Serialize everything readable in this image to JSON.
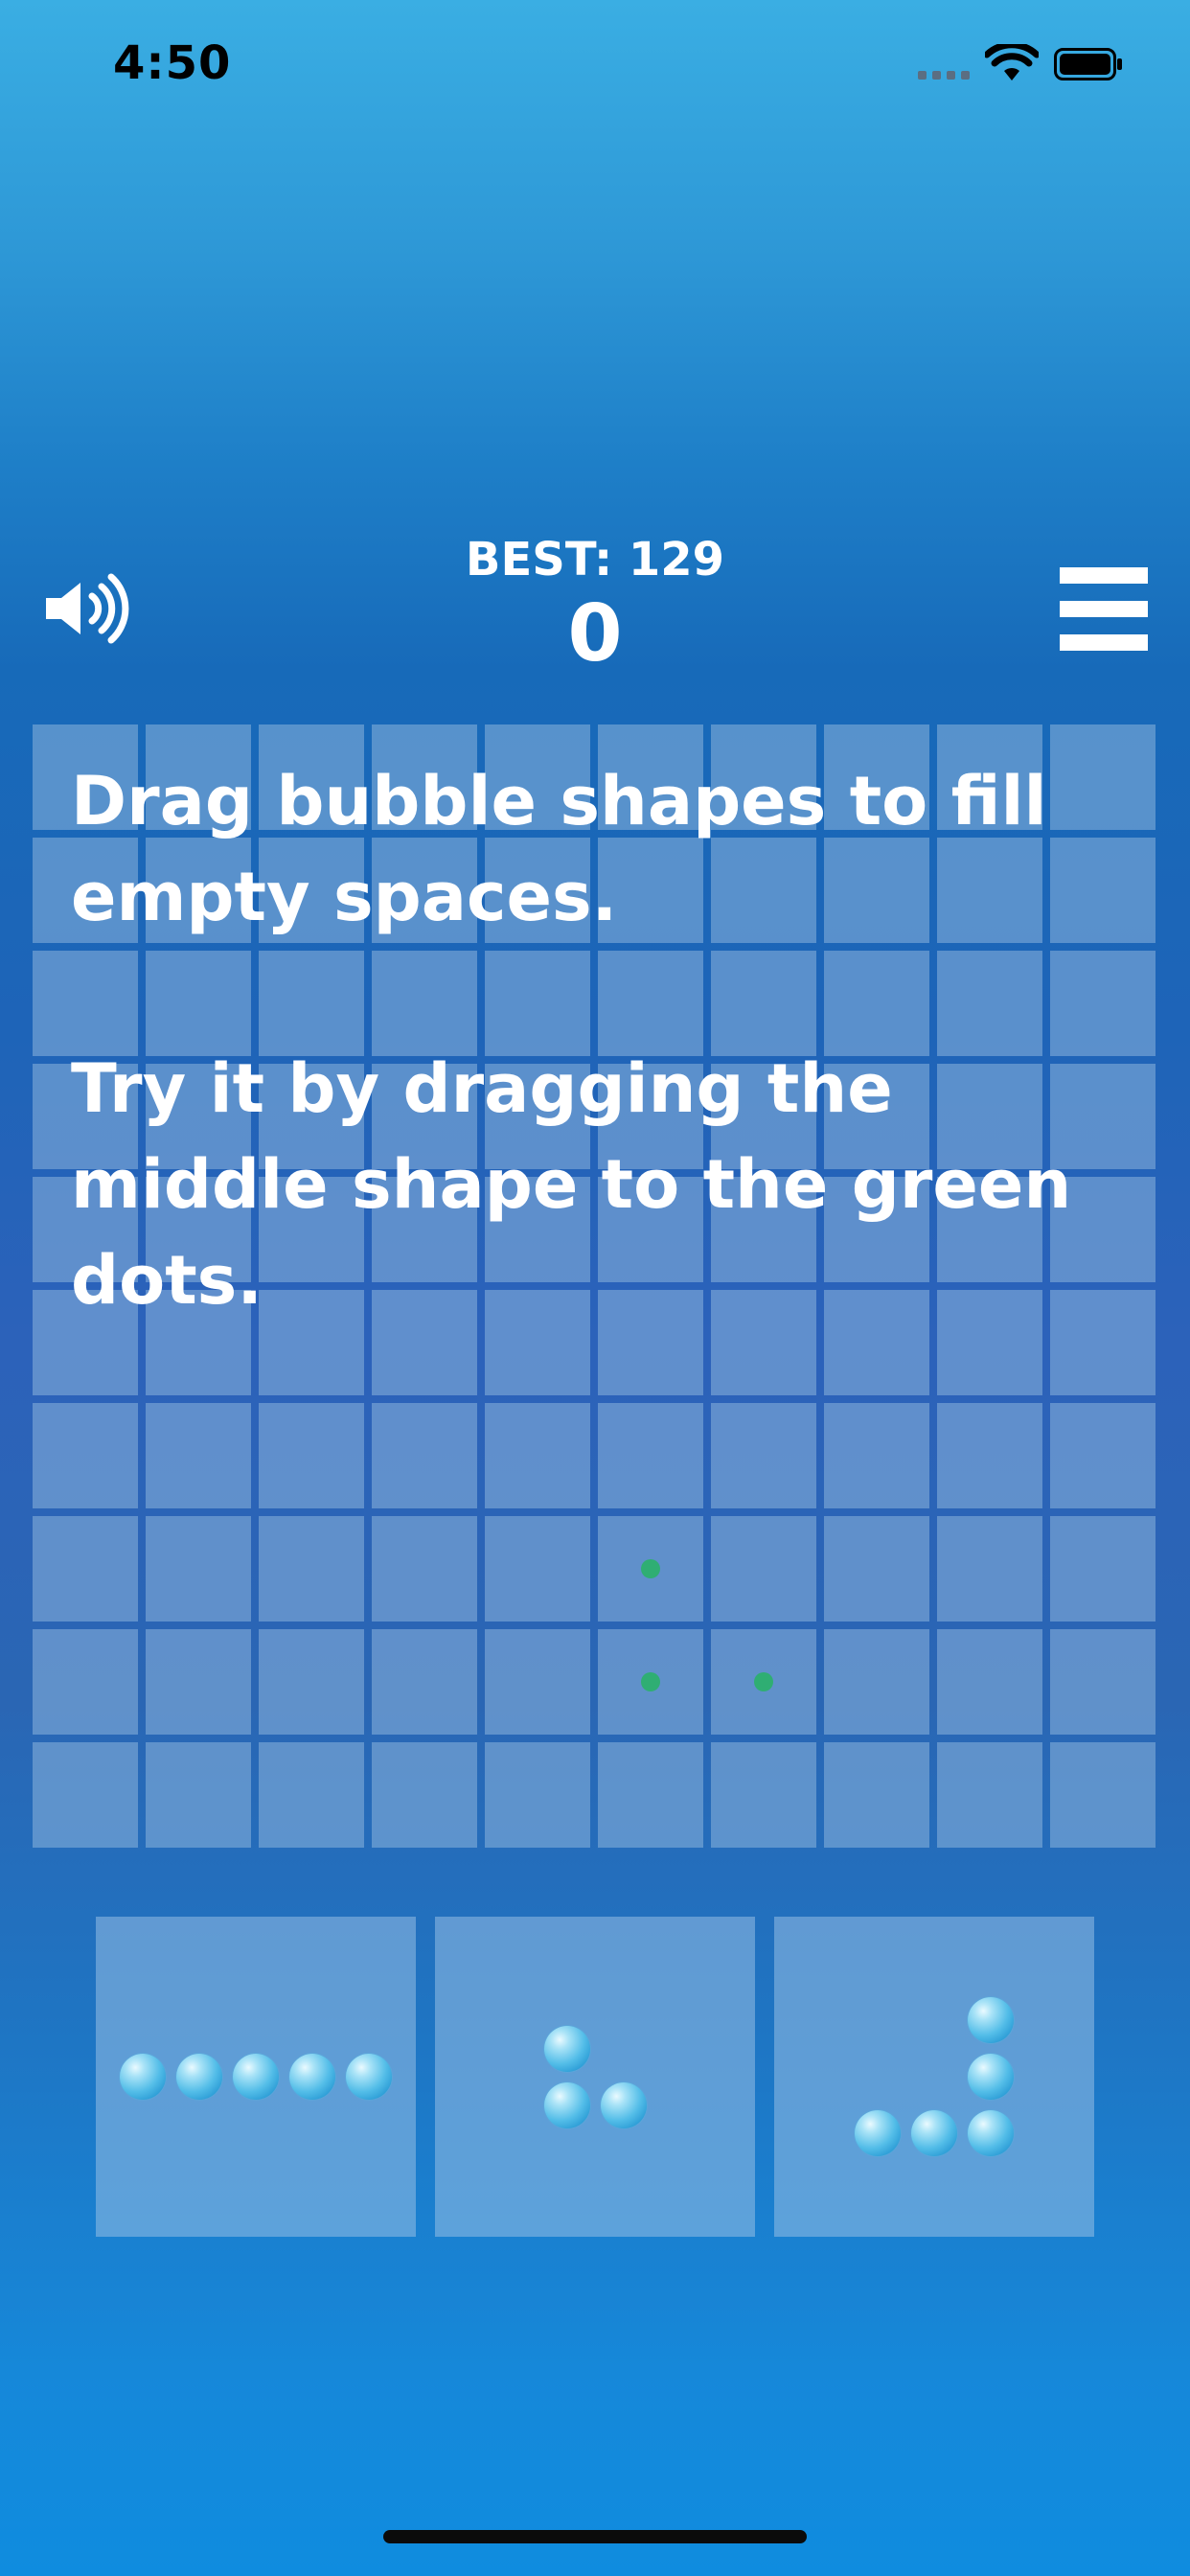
{
  "status_bar": {
    "time": "4:50",
    "icons": [
      "cellular-signal-icon",
      "wifi-icon",
      "battery-icon"
    ]
  },
  "header": {
    "best_label": "BEST: 129",
    "score": "0",
    "sound_icon": "speaker-on-icon",
    "menu_icon": "hamburger-menu-icon"
  },
  "board": {
    "rows": 10,
    "cols": 10,
    "hint_dots": [
      [
        7,
        5
      ],
      [
        8,
        5
      ],
      [
        8,
        6
      ]
    ],
    "hint_color": "#2fae73"
  },
  "instructions": {
    "line1": "Drag bubble shapes to fill",
    "line2": "empty spaces.",
    "line3": "Try it by dragging the",
    "line4": "middle shape to the green",
    "line5": "dots."
  },
  "pieces": [
    {
      "name": "horizontal-five-line",
      "cells": [
        [
          0,
          0
        ],
        [
          0,
          1
        ],
        [
          0,
          2
        ],
        [
          0,
          3
        ],
        [
          0,
          4
        ]
      ]
    },
    {
      "name": "small-corner-three",
      "cells": [
        [
          0,
          0
        ],
        [
          1,
          0
        ],
        [
          1,
          1
        ]
      ]
    },
    {
      "name": "large-corner-five",
      "cells": [
        [
          0,
          2
        ],
        [
          1,
          2
        ],
        [
          2,
          0
        ],
        [
          2,
          1
        ],
        [
          2,
          2
        ]
      ]
    }
  ],
  "colors": {
    "background_top": "#3aaee3",
    "background_bottom": "#0f8cdf",
    "bubble": "#53bde8"
  }
}
